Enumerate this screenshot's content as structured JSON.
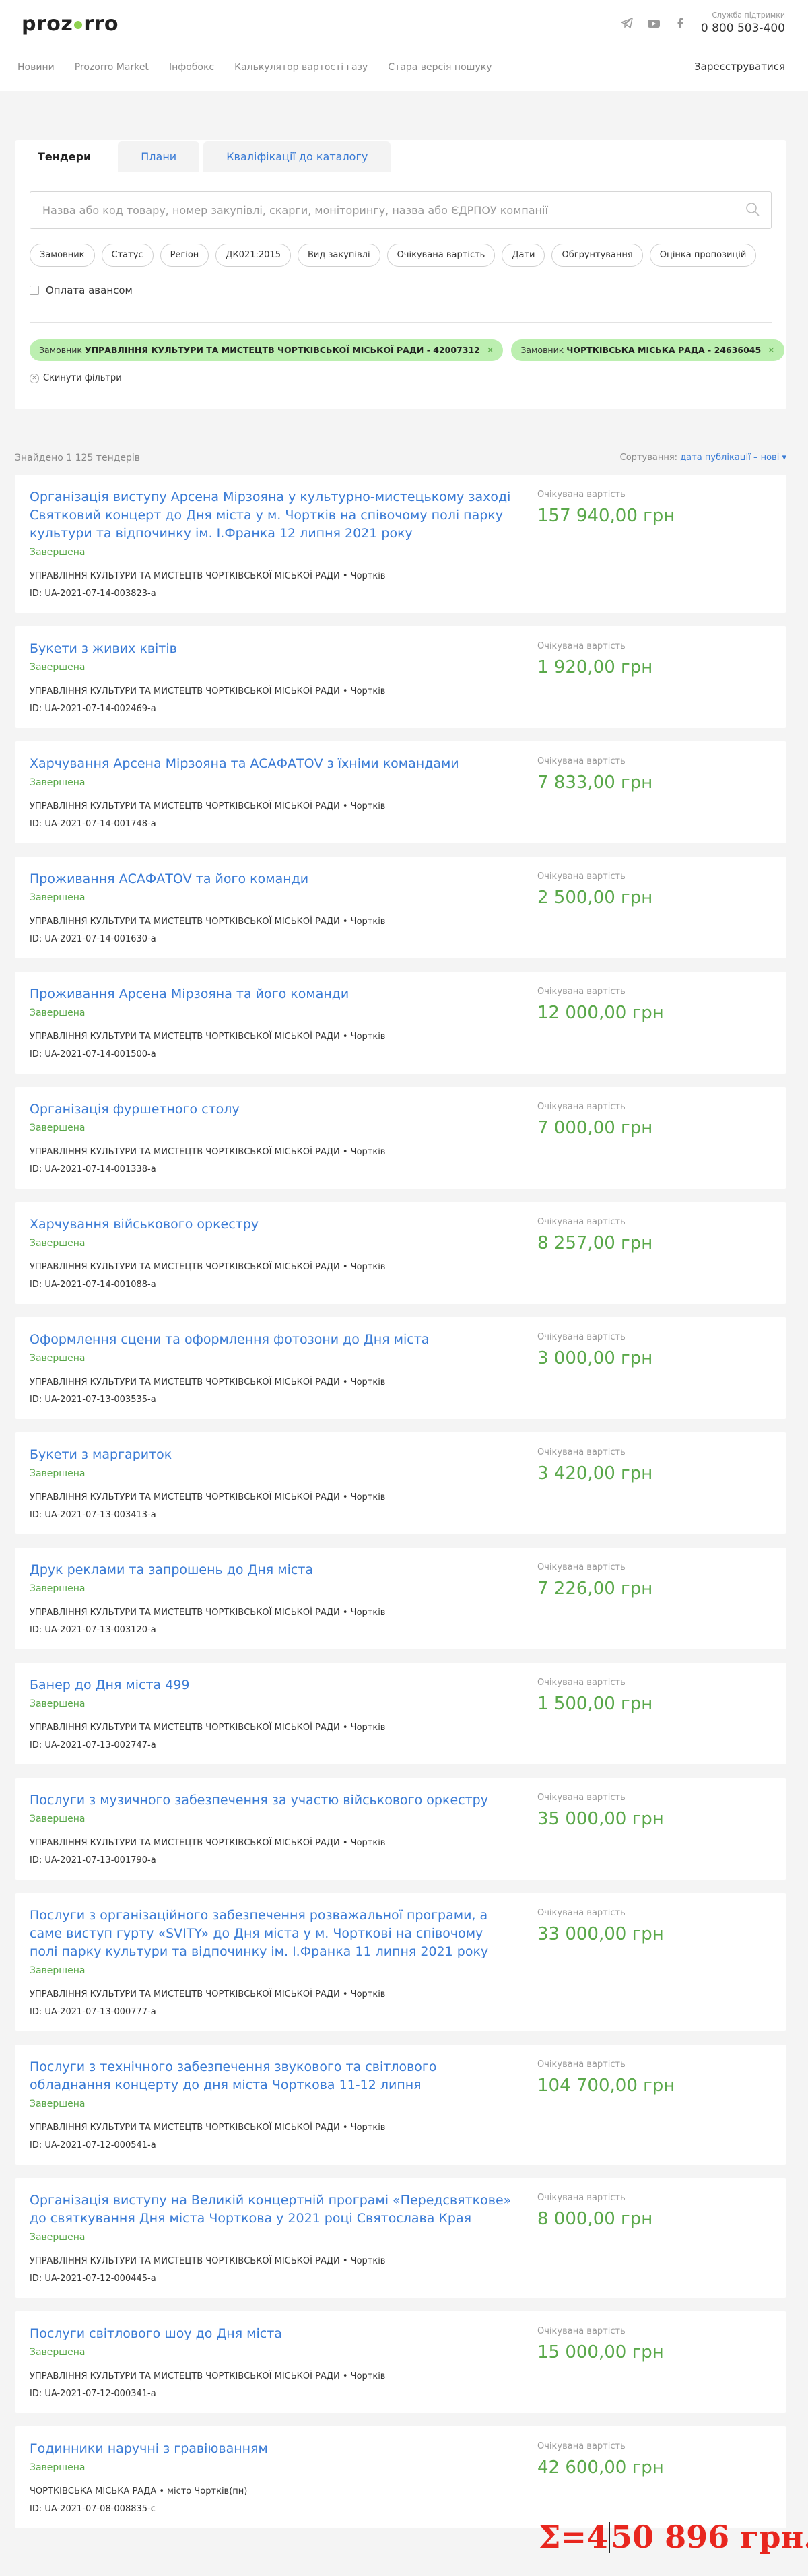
{
  "header": {
    "logo": "prozorro",
    "support_label": "Служба підтримки",
    "support_phone": "0 800 503-400",
    "nav": [
      "Новини",
      "Prozorro Market",
      "Інфобокс",
      "Калькулятор вартості газу",
      "Стара версія пошуку"
    ],
    "register": "Зареєструватися",
    "social_icons": [
      "telegram-icon",
      "youtube-icon",
      "facebook-icon"
    ]
  },
  "tabs": [
    {
      "label": "Тендери",
      "active": true
    },
    {
      "label": "Плани",
      "active": false
    },
    {
      "label": "Кваліфікації до каталогу",
      "active": false
    }
  ],
  "search": {
    "placeholder": "Назва або код товару, номер закупівлі, скарги, моніторингу, назва або ЄДРПОУ компанії",
    "value": ""
  },
  "chips": [
    "Замовник",
    "Статус",
    "Регіон",
    "ДК021:2015",
    "Вид закупівлі",
    "Очікувана вартість",
    "Дати",
    "Обґрунтування",
    "Оцінка пропозицій"
  ],
  "advance_payment": "Оплата авансом",
  "active_filters": [
    {
      "prefix": "Замовник",
      "value": "УПРАВЛІННЯ КУЛЬТУРИ ТА МИСТЕЦТВ ЧОРТКІВСЬКОЇ МІСЬКОЇ РАДИ - 42007312"
    },
    {
      "prefix": "Замовник",
      "value": "ЧОРТКІВСЬКА МІСЬКА РАДА - 24636045"
    }
  ],
  "clear_filters": "Скинути фільтри",
  "results": {
    "found": "Знайдено 1 125 тендерів",
    "sort_label": "Сортування:",
    "sort_value": "дата публікації – нові",
    "value_label": "Очікувана вартість",
    "items": [
      {
        "title": "Організація виступу Арсена Мірзояна у культурно-мистецькому заході Святковий концерт до Дня міста у м. Чортків на співочому полі парку культури та відпочинку ім. І.Франка 12 липня 2021 року",
        "status": "Завершена",
        "org": "УПРАВЛІННЯ КУЛЬТУРИ ТА МИСТЕЦТВ ЧОРТКІВСЬКОЇ МІСЬКОЇ РАДИ • Чортків",
        "id": "ID: UA-2021-07-14-003823-a",
        "value": "157 940,00 грн"
      },
      {
        "title": "Букети з живих квітів",
        "status": "Завершена",
        "org": "УПРАВЛІННЯ КУЛЬТУРИ ТА МИСТЕЦТВ ЧОРТКІВСЬКОЇ МІСЬКОЇ РАДИ • Чортків",
        "id": "ID: UA-2021-07-14-002469-a",
        "value": "1 920,00 грн"
      },
      {
        "title": "Харчування Арсена Мірзояна та АСАФАТОV з їхніми командами",
        "status": "Завершена",
        "org": "УПРАВЛІННЯ КУЛЬТУРИ ТА МИСТЕЦТВ ЧОРТКІВСЬКОЇ МІСЬКОЇ РАДИ • Чортків",
        "id": "ID: UA-2021-07-14-001748-a",
        "value": "7 833,00 грн"
      },
      {
        "title": "Проживання АСАФАТОV та його команди",
        "status": "Завершена",
        "org": "УПРАВЛІННЯ КУЛЬТУРИ ТА МИСТЕЦТВ ЧОРТКІВСЬКОЇ МІСЬКОЇ РАДИ • Чортків",
        "id": "ID: UA-2021-07-14-001630-a",
        "value": "2 500,00 грн"
      },
      {
        "title": "Проживання Арсена Мірзояна та його команди",
        "status": "Завершена",
        "org": "УПРАВЛІННЯ КУЛЬТУРИ ТА МИСТЕЦТВ ЧОРТКІВСЬКОЇ МІСЬКОЇ РАДИ • Чортків",
        "id": "ID: UA-2021-07-14-001500-a",
        "value": "12 000,00 грн"
      },
      {
        "title": "Організація фуршетного столу",
        "status": "Завершена",
        "org": "УПРАВЛІННЯ КУЛЬТУРИ ТА МИСТЕЦТВ ЧОРТКІВСЬКОЇ МІСЬКОЇ РАДИ • Чортків",
        "id": "ID: UA-2021-07-14-001338-a",
        "value": "7 000,00 грн"
      },
      {
        "title": "Харчування військового оркестру",
        "status": "Завершена",
        "org": "УПРАВЛІННЯ КУЛЬТУРИ ТА МИСТЕЦТВ ЧОРТКІВСЬКОЇ МІСЬКОЇ РАДИ • Чортків",
        "id": "ID: UA-2021-07-14-001088-a",
        "value": "8 257,00 грн"
      },
      {
        "title": "Оформлення сцени та оформлення фотозони до Дня міста",
        "status": "Завершена",
        "org": "УПРАВЛІННЯ КУЛЬТУРИ ТА МИСТЕЦТВ ЧОРТКІВСЬКОЇ МІСЬКОЇ РАДИ • Чортків",
        "id": "ID: UA-2021-07-13-003535-a",
        "value": "3 000,00 грн"
      },
      {
        "title": "Букети з маргариток",
        "status": "Завершена",
        "org": "УПРАВЛІННЯ КУЛЬТУРИ ТА МИСТЕЦТВ ЧОРТКІВСЬКОЇ МІСЬКОЇ РАДИ • Чортків",
        "id": "ID: UA-2021-07-13-003413-a",
        "value": "3 420,00 грн"
      },
      {
        "title": "Друк реклами та запрошень до Дня міста",
        "status": "Завершена",
        "org": "УПРАВЛІННЯ КУЛЬТУРИ ТА МИСТЕЦТВ ЧОРТКІВСЬКОЇ МІСЬКОЇ РАДИ • Чортків",
        "id": "ID: UA-2021-07-13-003120-a",
        "value": "7 226,00 грн"
      },
      {
        "title": "Банер до Дня міста 499",
        "status": "Завершена",
        "org": "УПРАВЛІННЯ КУЛЬТУРИ ТА МИСТЕЦТВ ЧОРТКІВСЬКОЇ МІСЬКОЇ РАДИ • Чортків",
        "id": "ID: UA-2021-07-13-002747-a",
        "value": "1 500,00 грн"
      },
      {
        "title": "Послуги з музичного забезпечення за участю військового оркестру",
        "status": "Завершена",
        "org": "УПРАВЛІННЯ КУЛЬТУРИ ТА МИСТЕЦТВ ЧОРТКІВСЬКОЇ МІСЬКОЇ РАДИ • Чортків",
        "id": "ID: UA-2021-07-13-001790-a",
        "value": "35 000,00 грн"
      },
      {
        "title": "Послуги з організаційного забезпечення розважальної програми, а саме виступ гурту «SVITY» до Дня міста у м. Чорткові на співочому полі парку культури та відпочинку ім. І.Франка 11 липня 2021 року",
        "status": "Завершена",
        "org": "УПРАВЛІННЯ КУЛЬТУРИ ТА МИСТЕЦТВ ЧОРТКІВСЬКОЇ МІСЬКОЇ РАДИ • Чортків",
        "id": "ID: UA-2021-07-13-000777-a",
        "value": "33 000,00 грн"
      },
      {
        "title": "Послуги з технічного забезпечення звукового та світлового обладнання концерту до дня міста Чорткова 11-12 липня",
        "status": "Завершена",
        "org": "УПРАВЛІННЯ КУЛЬТУРИ ТА МИСТЕЦТВ ЧОРТКІВСЬКОЇ МІСЬКОЇ РАДИ • Чортків",
        "id": "ID: UA-2021-07-12-000541-a",
        "value": "104 700,00 грн"
      },
      {
        "title": "Організація виступу на Великій концертній програмі «Передсвяткове» до святкування Дня міста Чорткова у 2021 році Святослава Края",
        "status": "Завершена",
        "org": "УПРАВЛІННЯ КУЛЬТУРИ ТА МИСТЕЦТВ ЧОРТКІВСЬКОЇ МІСЬКОЇ РАДИ • Чортків",
        "id": "ID: UA-2021-07-12-000445-a",
        "value": "8 000,00 грн"
      },
      {
        "title": "Послуги світлового шоу до Дня міста",
        "status": "Завершена",
        "org": "УПРАВЛІННЯ КУЛЬТУРИ ТА МИСТЕЦТВ ЧОРТКІВСЬКОЇ МІСЬКОЇ РАДИ • Чортків",
        "id": "ID: UA-2021-07-12-000341-a",
        "value": "15 000,00 грн"
      },
      {
        "title": "Годинники наручні з гравіюванням",
        "status": "Завершена",
        "org": "ЧОРТКІВСЬКА МІСЬКА РАДА • місто Чортків(пн)",
        "id": "ID: UA-2021-07-08-008835-c",
        "value": "42 600,00 грн"
      }
    ]
  },
  "overlay_sum": "Σ=450 896 грн.",
  "colors": {
    "accent_blue": "#3a7bd5",
    "status_green": "#5aa84a",
    "filter_green": "#bcefb0",
    "sum_red": "#e8261e"
  }
}
